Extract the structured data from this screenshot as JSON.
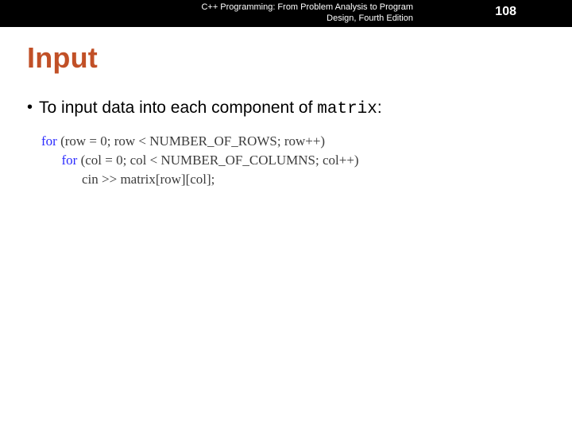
{
  "header": {
    "book_title_line1": "C++ Programming: From Problem Analysis to Program",
    "book_title_line2": "Design, Fourth Edition",
    "page_number": "108"
  },
  "title": "Input",
  "bullet": {
    "prefix": "To input data into each component of ",
    "code_word": "matrix",
    "suffix": ":"
  },
  "code": {
    "kw_for1": "for",
    "line1_rest": " (row = 0; row < NUMBER_OF_ROWS; row++)",
    "indent2": "      ",
    "kw_for2": "for",
    "line2_rest": " (col = 0; col < NUMBER_OF_COLUMNS; col++)",
    "indent3": "            ",
    "line3": "cin >> matrix[row][col];"
  }
}
